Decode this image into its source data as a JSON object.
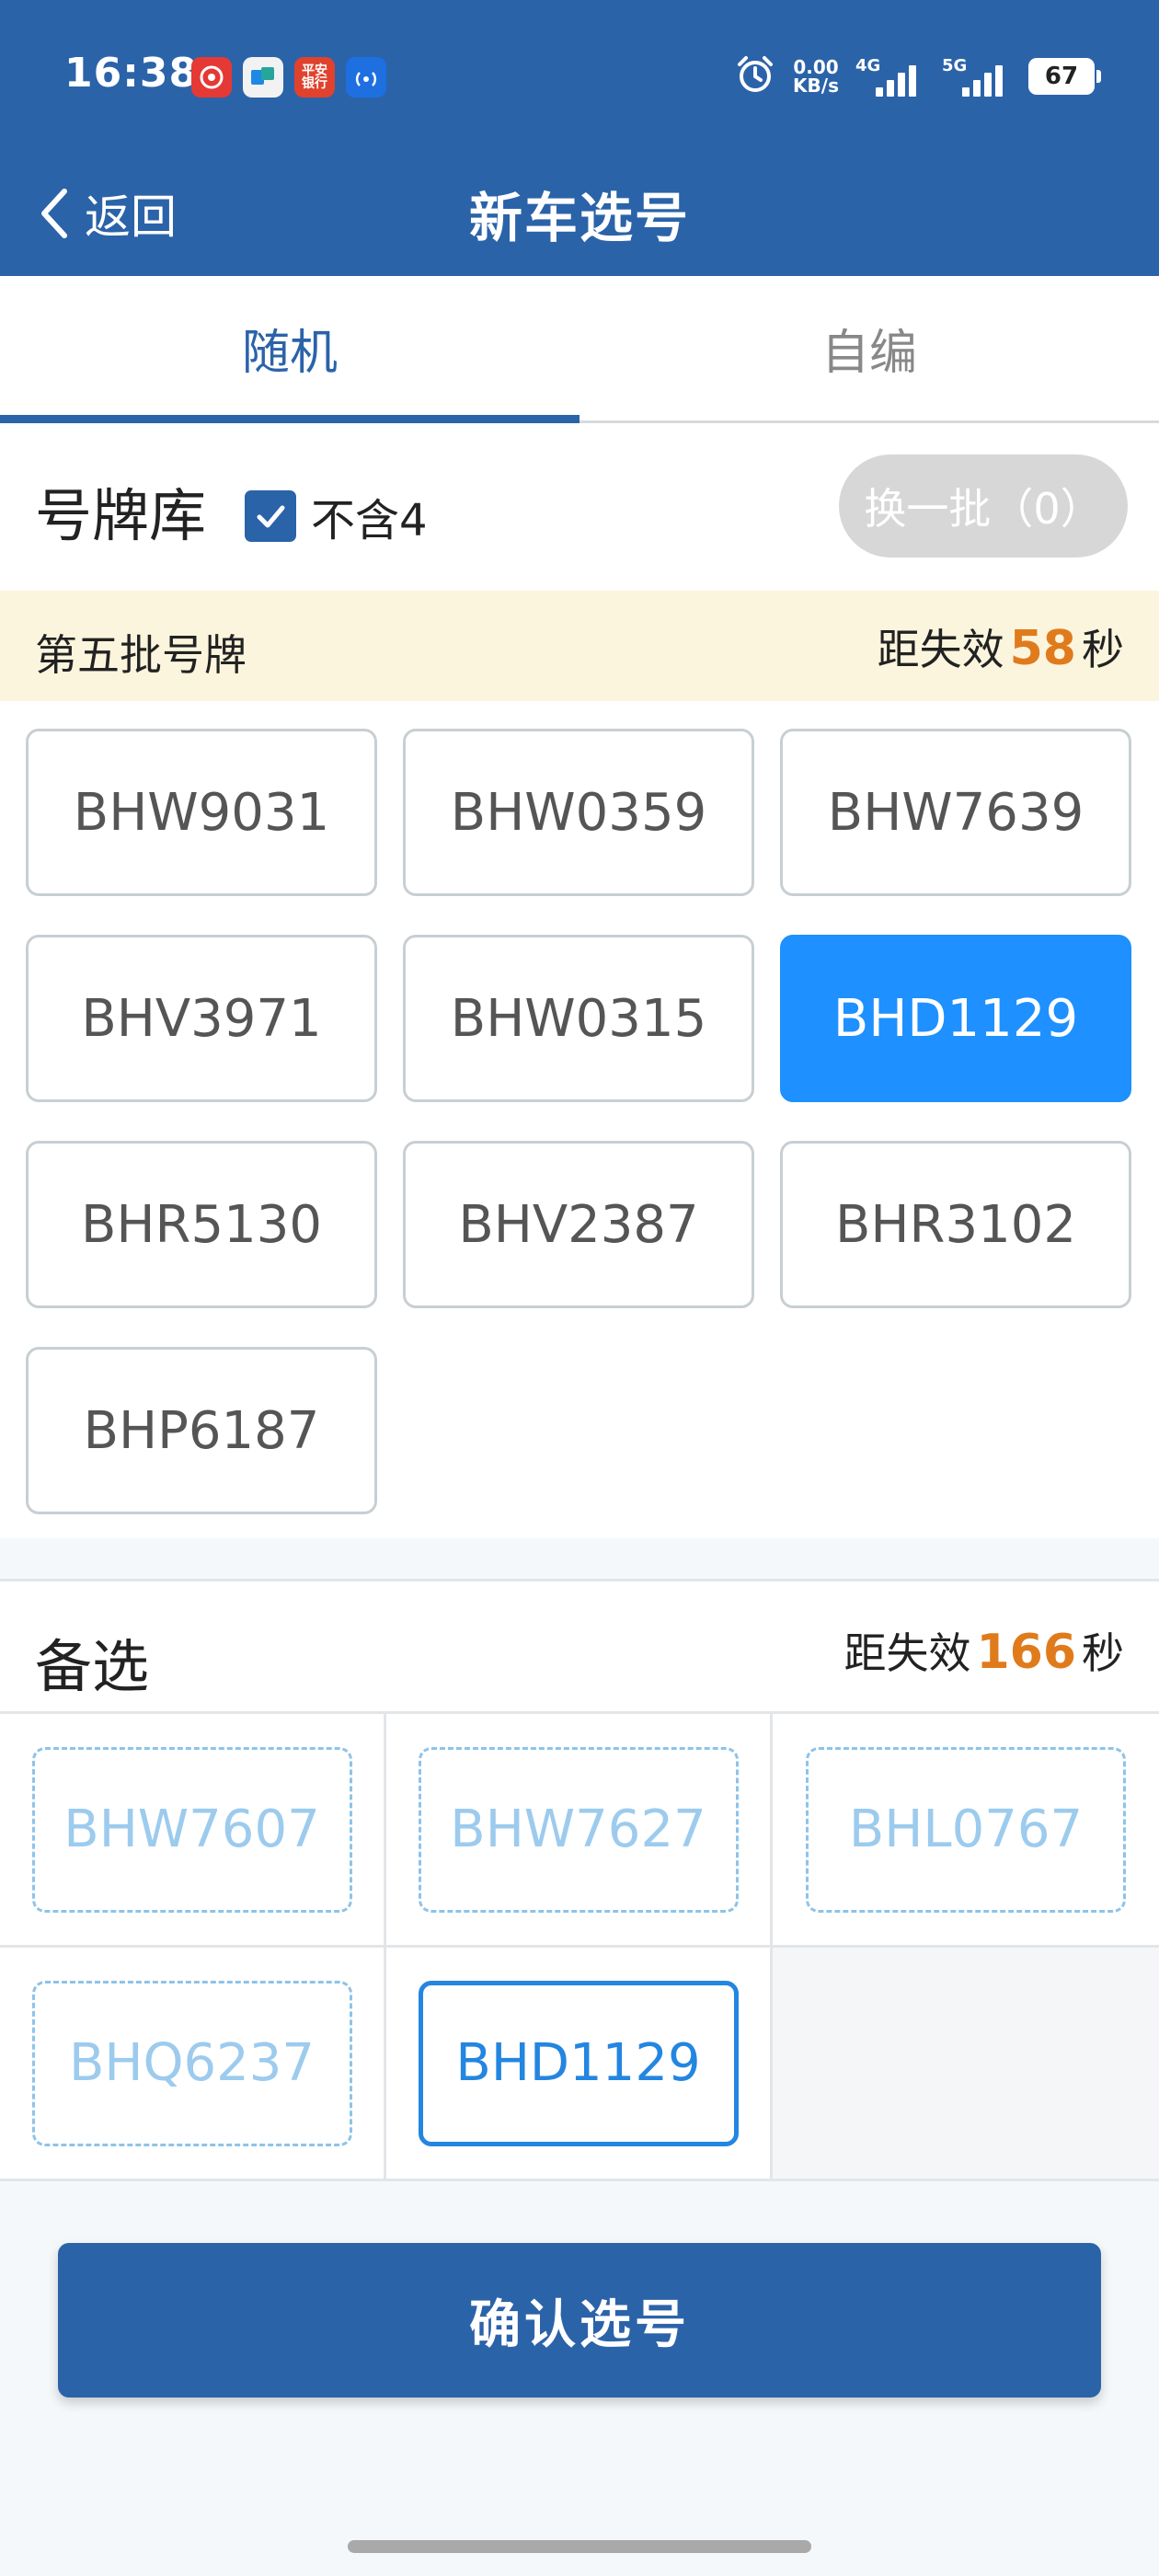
{
  "status_bar": {
    "time": "16:38",
    "apps": [
      "netease-music-icon",
      "app-icon",
      "pingan-bank-icon",
      "nfc-icon"
    ],
    "pingan_label_1": "平安",
    "pingan_label_2": "银行",
    "net_speed": "0.00",
    "net_unit": "KB/s",
    "sig1_label": "4G",
    "sig2_label": "5G",
    "battery": "67"
  },
  "header": {
    "back_label": "返回",
    "title": "新车选号",
    "bg_color": "#2b63a9"
  },
  "tabs": [
    {
      "label": "随机",
      "active": true
    },
    {
      "label": "自编",
      "active": false
    }
  ],
  "pool": {
    "title": "号牌库",
    "exclude_four": {
      "label": "不含4",
      "checked": true
    },
    "refresh_label": "换一批（0）",
    "batch_name": "第五批号牌",
    "expire_prefix": "距失效",
    "expire_value": "58",
    "expire_unit": "秒",
    "plates": [
      {
        "text": "BHW9031",
        "selected": false
      },
      {
        "text": "BHW0359",
        "selected": false
      },
      {
        "text": "BHW7639",
        "selected": false
      },
      {
        "text": "BHV3971",
        "selected": false
      },
      {
        "text": "BHW0315",
        "selected": false
      },
      {
        "text": "BHD1129",
        "selected": true
      },
      {
        "text": "BHR5130",
        "selected": false
      },
      {
        "text": "BHV2387",
        "selected": false
      },
      {
        "text": "BHR3102",
        "selected": false
      },
      {
        "text": "BHP6187",
        "selected": false
      }
    ]
  },
  "alternates": {
    "title": "备选",
    "expire_prefix": "距失效",
    "expire_value": "166",
    "expire_unit": "秒",
    "items": [
      {
        "text": "BHW7607",
        "chosen": false
      },
      {
        "text": "BHW7627",
        "chosen": false
      },
      {
        "text": "BHL0767",
        "chosen": false
      },
      {
        "text": "BHQ6237",
        "chosen": false
      },
      {
        "text": "BHD1129",
        "chosen": true
      }
    ]
  },
  "confirm_label": "确认选号",
  "colors": {
    "primary": "#2b63a9",
    "selected_plate": "#1e90ff",
    "countdown": "#e07b1c",
    "banner": "#fcf5de"
  }
}
